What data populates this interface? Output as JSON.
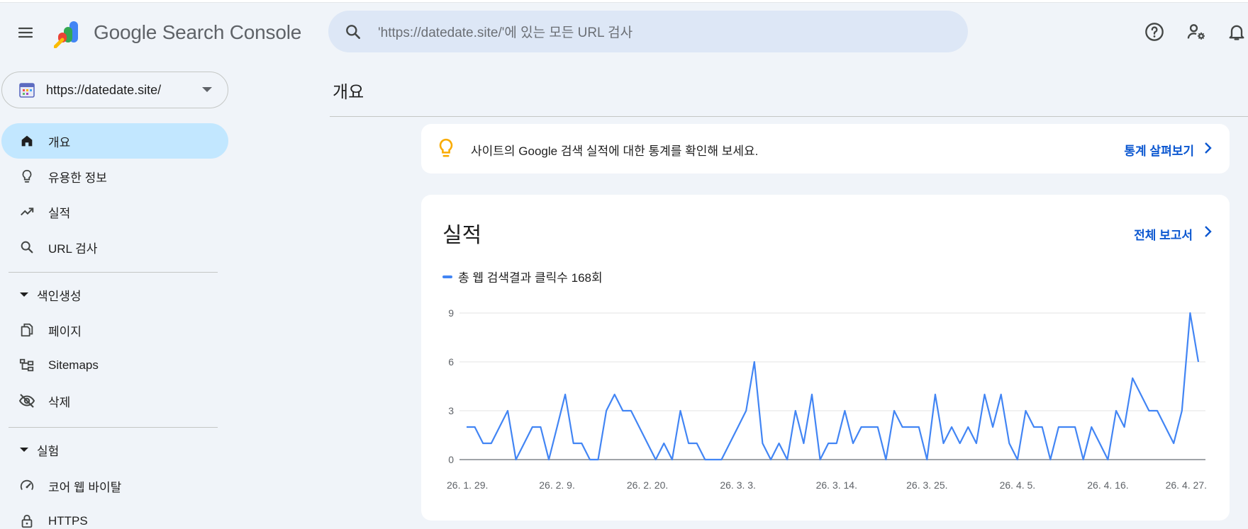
{
  "app": {
    "logo_google": "Google",
    "logo_product": "Search Console"
  },
  "search": {
    "placeholder": "'https://datedate.site/'에 있는 모든 URL 검사"
  },
  "header_icons": [
    "help-icon",
    "manage-users-icon",
    "notifications-icon"
  ],
  "property": {
    "name": "https://datedate.site/"
  },
  "sidebar": {
    "items": [
      {
        "label": "개요",
        "icon": "home-icon",
        "active": true
      },
      {
        "label": "유용한 정보",
        "icon": "lightbulb-icon"
      },
      {
        "label": "실적",
        "icon": "trending-up-icon"
      },
      {
        "label": "URL 검사",
        "icon": "search-icon"
      }
    ],
    "section_indexing": "색인생성",
    "indexing_items": [
      {
        "label": "페이지",
        "icon": "pages-icon"
      },
      {
        "label": "Sitemaps",
        "icon": "sitemap-icon"
      },
      {
        "label": "삭제",
        "icon": "visibility-off-icon"
      }
    ],
    "section_experience": "실험",
    "experience_items": [
      {
        "label": "코어 웹 바이탈",
        "icon": "speed-icon"
      },
      {
        "label": "HTTPS",
        "icon": "lock-icon"
      }
    ]
  },
  "main": {
    "title": "개요",
    "tip": {
      "text": "사이트의 Google 검색 실적에 대한 통계를 확인해 보세요.",
      "link": "통계 살펴보기"
    },
    "performance": {
      "title": "실적",
      "link": "전체 보고서",
      "legend": "총 웹 검색결과 클릭수 168회"
    }
  },
  "colors": {
    "accent": "#0b57d0",
    "series": "#4285f4",
    "active_nav": "#c2e7ff",
    "bulb": "#f9ab00"
  },
  "chart_data": {
    "type": "line",
    "series": [
      {
        "name": "총 웹 검색결과 클릭수",
        "values": [
          2,
          2,
          1,
          1,
          2,
          3,
          0,
          1,
          2,
          2,
          0,
          2,
          4,
          1,
          1,
          0,
          0,
          3,
          4,
          3,
          3,
          2,
          1,
          0,
          1,
          0,
          3,
          1,
          1,
          0,
          0,
          0,
          1,
          2,
          3,
          6,
          1,
          0,
          1,
          0,
          3,
          1,
          4,
          0,
          1,
          1,
          3,
          1,
          2,
          2,
          2,
          0,
          3,
          2,
          2,
          2,
          0,
          4,
          1,
          2,
          1,
          2,
          1,
          4,
          2,
          4,
          1,
          0,
          3,
          2,
          2,
          0,
          2,
          2,
          2,
          0,
          2,
          1,
          0,
          3,
          2,
          5,
          4,
          3,
          3,
          2,
          1,
          3,
          9,
          6
        ]
      }
    ],
    "x_tick_labels": [
      "26. 1. 29.",
      "26. 2. 9.",
      "26. 2. 20.",
      "26. 3. 3.",
      "26. 3. 14.",
      "26. 3. 25.",
      "26. 4. 5.",
      "26. 4. 16.",
      "26. 4. 27."
    ],
    "y_ticks": [
      0,
      3,
      6,
      9
    ],
    "ylim": [
      0,
      9
    ],
    "grid": true
  }
}
